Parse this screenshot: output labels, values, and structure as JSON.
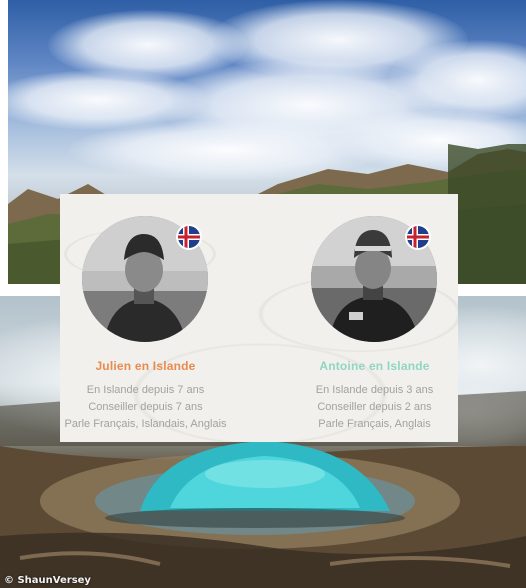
{
  "advisors": [
    {
      "name": "Julien en Islande",
      "line1": "En Islande depuis 7 ans",
      "line2": "Conseiller depuis 7 ans",
      "line3": "Parle Français, Islandais, Anglais",
      "name_color": "#e98a4e",
      "flag_icon": "iceland-flag-icon"
    },
    {
      "name": "Antoine en Islande",
      "line1": "En Islande depuis 3 ans",
      "line2": "Conseiller depuis 2 ans",
      "line3": "Parle Français, Anglais",
      "name_color": "#8fd6c4",
      "flag_icon": "iceland-flag-icon"
    }
  ],
  "photo_credit": "© ShaunVersey"
}
